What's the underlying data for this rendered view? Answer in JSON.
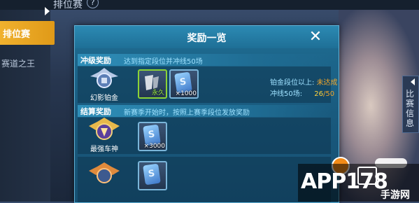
{
  "background": {
    "title": "排位赛",
    "help": "?",
    "side_tab": "排位赛",
    "side_item": "赛道之王",
    "right_tab": "比赛信息"
  },
  "modal": {
    "title": "奖励一览",
    "close": "✕",
    "level_reward": {
      "title": "冲级奖励",
      "desc": "达到指定段位并冲线50场",
      "rank": "幻影铂金",
      "items": [
        {
          "name": "permanent-item",
          "tag": "永久"
        },
        {
          "name": "coupon-card",
          "qty": "×1000"
        }
      ],
      "status_label_1": "铂金段位以上:",
      "status_value_1": "未达成",
      "status_label_2": "冲线50场:",
      "status_progress": "26",
      "status_sep": "/",
      "status_total": "50"
    },
    "settle_reward": {
      "title": "结算奖励",
      "desc": "新赛季开始时，按照上赛季段位发放奖励",
      "rows": [
        {
          "rank": "最强车神",
          "qty": "×3000"
        },
        {
          "rank": "",
          "qty": ""
        }
      ]
    }
  },
  "watermark": {
    "text": "APP178",
    "sub": "手游网"
  },
  "colors": {
    "modal_bg": "#195a7e",
    "accent_yellow": "#f0a52a",
    "desc_text": "#9fe2ff",
    "side_tab": "#f0b12e"
  }
}
